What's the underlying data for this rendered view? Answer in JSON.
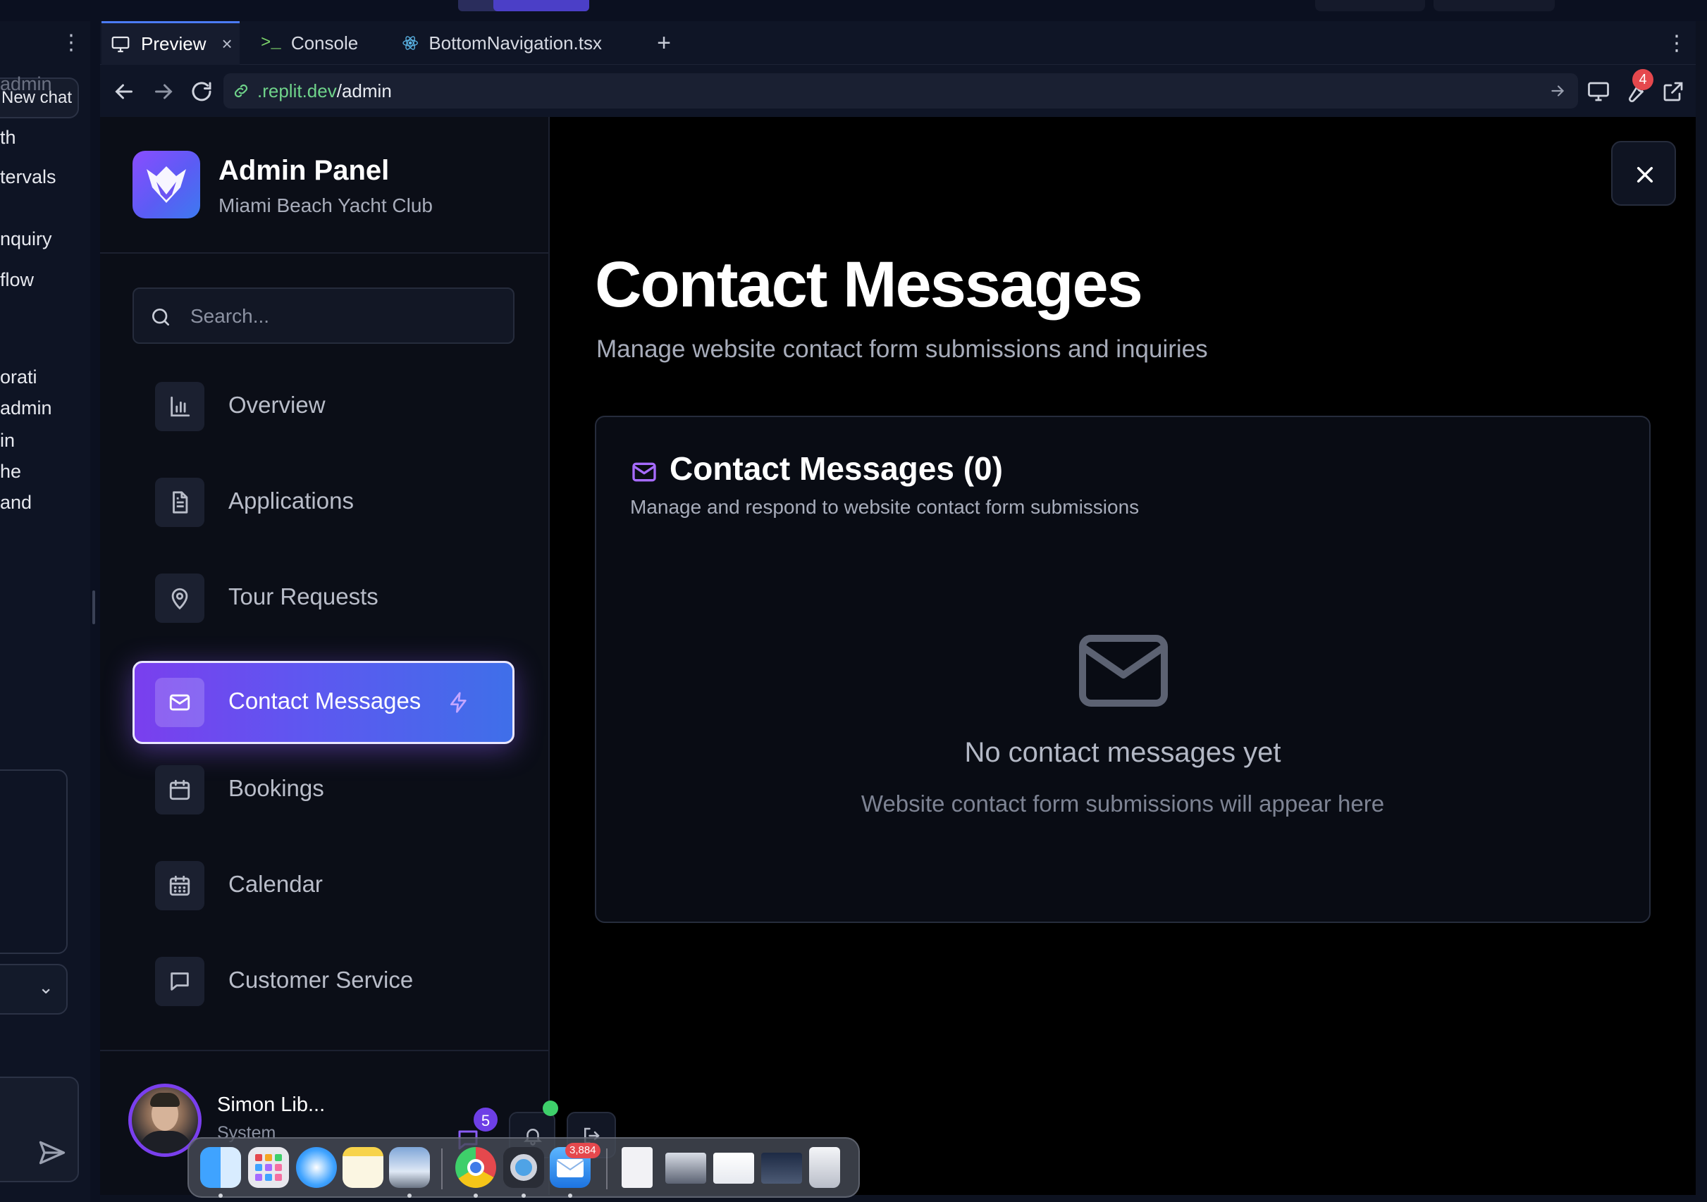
{
  "chat_panel": {
    "new_chat_label": "New chat",
    "fragments": [
      "admin",
      "th",
      "tervals",
      "nquiry",
      "flow",
      "orati",
      "admin",
      "in",
      "he",
      "and"
    ]
  },
  "tabs": [
    {
      "label": "Preview",
      "icon": "monitor-icon",
      "active": true
    },
    {
      "label": "Console",
      "icon": "terminal-icon",
      "active": false
    },
    {
      "label": "BottomNavigation.tsx",
      "icon": "react-icon",
      "active": false
    }
  ],
  "address_bar": {
    "domain": ".replit.dev",
    "path": "/admin",
    "tools_badge": "4"
  },
  "brand": {
    "title": "Admin Panel",
    "subtitle": "Miami Beach Yacht Club"
  },
  "search": {
    "placeholder": "Search..."
  },
  "nav": [
    {
      "label": "Overview",
      "icon": "bar-chart-icon",
      "active": false
    },
    {
      "label": "Applications",
      "icon": "file-text-icon",
      "active": false
    },
    {
      "label": "Tour Requests",
      "icon": "map-pin-icon",
      "active": false
    },
    {
      "label": "Contact Messages",
      "icon": "mail-icon",
      "active": true
    },
    {
      "label": "Bookings",
      "icon": "calendar-icon",
      "active": false
    },
    {
      "label": "Calendar",
      "icon": "calendar-days-icon",
      "active": false
    },
    {
      "label": "Customer Service",
      "icon": "message-square-icon",
      "active": false
    }
  ],
  "user": {
    "name": "Simon Lib...",
    "role": "System",
    "messages_badge": "5"
  },
  "page": {
    "title": "Contact Messages",
    "subtitle": "Manage website contact form submissions and inquiries"
  },
  "card": {
    "title": "Contact Messages (0)",
    "subtitle": "Manage and respond to website contact form submissions",
    "empty_title": "No contact messages yet",
    "empty_subtitle": "Website contact form submissions will appear here"
  },
  "dock": {
    "mail_badge": "3,884"
  },
  "colors": {
    "accent_purple": "#7a3fee",
    "accent_blue": "#3f6fe9",
    "url_domain_green": "#6fd38a",
    "online_green": "#3ecf6a",
    "badge_red": "#e5484d"
  }
}
